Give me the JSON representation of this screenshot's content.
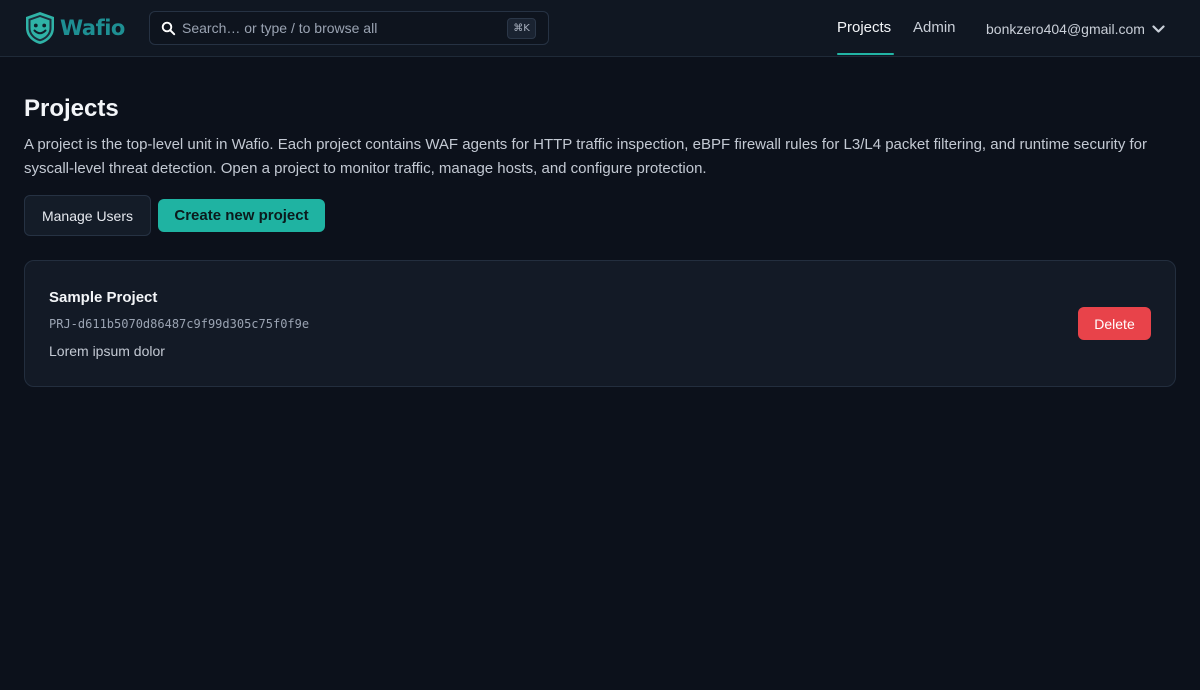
{
  "header": {
    "brand": "Wafio",
    "search": {
      "placeholder": "Search… or type / to browse all",
      "shortcut": "⌘K"
    },
    "nav": {
      "projects_label": "Projects",
      "admin_label": "Admin",
      "active": "Projects"
    },
    "user": {
      "email": "bonkzero404@gmail.com"
    }
  },
  "main": {
    "title": "Projects",
    "description": "A project is the top-level unit in Wafio. Each project contains WAF agents for HTTP traffic inspection, eBPF firewall rules for L3/L4 packet filtering, and runtime security for syscall-level threat detection. Open a project to monitor traffic, manage hosts, and configure protection.",
    "actions": {
      "manage_users_label": "Manage Users",
      "create_project_label": "Create new project"
    },
    "projects": [
      {
        "name": "Sample Project",
        "id": "PRJ-d611b5070d86487c9f99d305c75f0f9e",
        "description": "Lorem ipsum dolor",
        "delete_label": "Delete"
      }
    ]
  },
  "colors": {
    "background": "#0c111b",
    "header": "#101722",
    "accent": "#1fb3a2",
    "danger": "#e8434a",
    "card": "#131a26"
  },
  "icons": {
    "logo": "shield-smile-icon",
    "search": "search-icon",
    "user_menu": "chevron-down-icon"
  }
}
